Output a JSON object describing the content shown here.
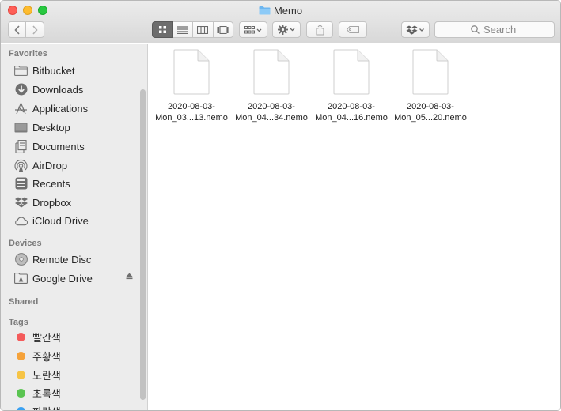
{
  "window": {
    "title": "Memo",
    "folder_icon": "folder-icon"
  },
  "toolbar": {
    "back_icon": "chevron-left-icon",
    "forward_icon": "chevron-right-icon",
    "views": [
      "icon-view",
      "list-view",
      "column-view",
      "gallery-view"
    ],
    "selected_view": "icon-view",
    "group_icon": "arrange-icon",
    "action_icon": "gear-icon",
    "share_icon": "share-icon",
    "tag_icon": "tag-icon",
    "dropbox_icon": "dropbox-icon",
    "search_placeholder": "Search"
  },
  "sidebar": {
    "favorites_label": "Favorites",
    "favorites": [
      {
        "label": "Bitbucket",
        "icon": "folder-icon"
      },
      {
        "label": "Downloads",
        "icon": "download-icon"
      },
      {
        "label": "Applications",
        "icon": "applications-icon"
      },
      {
        "label": "Desktop",
        "icon": "desktop-icon"
      },
      {
        "label": "Documents",
        "icon": "documents-icon"
      },
      {
        "label": "AirDrop",
        "icon": "airdrop-icon"
      },
      {
        "label": "Recents",
        "icon": "recents-icon"
      },
      {
        "label": "Dropbox",
        "icon": "dropbox-icon"
      },
      {
        "label": "iCloud Drive",
        "icon": "cloud-icon"
      }
    ],
    "devices_label": "Devices",
    "devices": [
      {
        "label": "Remote Disc",
        "icon": "disc-icon"
      },
      {
        "label": "Google Drive",
        "icon": "drive-icon",
        "ejectable": true
      }
    ],
    "shared_label": "Shared",
    "tags_label": "Tags",
    "tags": [
      {
        "label": "빨간색",
        "color": "#f45b5b"
      },
      {
        "label": "주황색",
        "color": "#f5a23a"
      },
      {
        "label": "노란색",
        "color": "#f6c445"
      },
      {
        "label": "초록색",
        "color": "#5ac451"
      },
      {
        "label": "파란색",
        "color": "#3aa1f2"
      }
    ]
  },
  "files": [
    {
      "line1": "2020-08-03-",
      "line2": "Mon_03...13.nemo"
    },
    {
      "line1": "2020-08-03-",
      "line2": "Mon_04...34.nemo"
    },
    {
      "line1": "2020-08-03-",
      "line2": "Mon_04...16.nemo"
    },
    {
      "line1": "2020-08-03-",
      "line2": "Mon_05...20.nemo"
    }
  ]
}
